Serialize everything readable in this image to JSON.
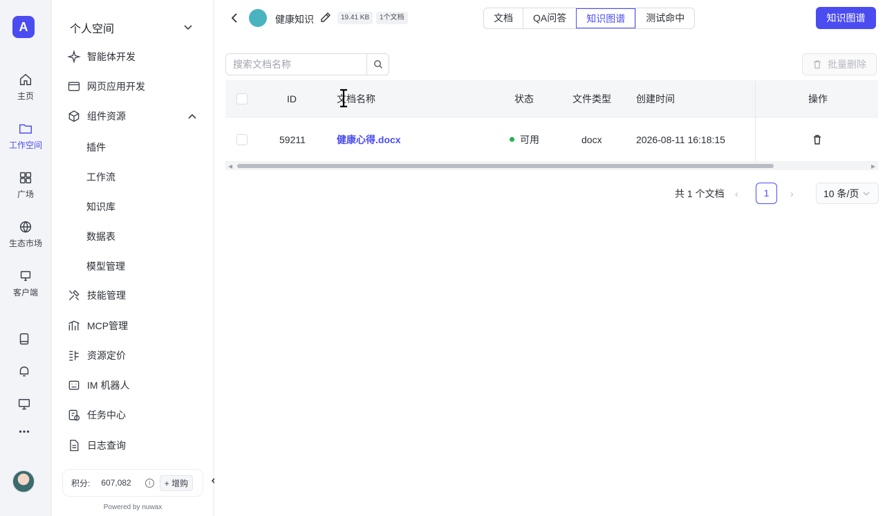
{
  "rail": {
    "logo": "A",
    "items": [
      {
        "label": "主页",
        "icon": "home-icon"
      },
      {
        "label": "工作空间",
        "icon": "folder-icon",
        "active": true
      },
      {
        "label": "广场",
        "icon": "grid-icon"
      },
      {
        "label": "生态市场",
        "icon": "globe-icon"
      },
      {
        "label": "客户端",
        "icon": "monitor-icon"
      }
    ],
    "bottom_icons": [
      "book-icon",
      "bell-icon",
      "desktop-icon",
      "more-icon"
    ]
  },
  "sidebar": {
    "title": "个人空间",
    "items": [
      {
        "label": "智能体开发",
        "icon": "sparkle-icon"
      },
      {
        "label": "网页应用开发",
        "icon": "browser-icon"
      },
      {
        "label": "组件资源",
        "icon": "cube-icon"
      },
      {
        "label": "技能管理",
        "icon": "tools-icon"
      },
      {
        "label": "MCP管理",
        "icon": "mcp-icon"
      },
      {
        "label": "资源定价",
        "icon": "pricing-icon"
      },
      {
        "label": "IM 机器人",
        "icon": "robot-icon"
      },
      {
        "label": "任务中心",
        "icon": "task-icon"
      },
      {
        "label": "日志查询",
        "icon": "log-icon"
      }
    ],
    "sub_items": [
      "插件",
      "工作流",
      "知识库",
      "数据表",
      "模型管理"
    ],
    "credit_label": "积分:",
    "credit_value": "607,082",
    "buy_label": "+ 增购",
    "powered": "Powered by nuwax"
  },
  "header": {
    "kb_name": "健康知识",
    "size_tag": "19.41 KB",
    "doc_tag": "1个文档",
    "tabs": [
      "文档",
      "QA问答",
      "知识图谱",
      "测试命中"
    ],
    "active_tab": "知识图谱",
    "primary_button": "知识图谱"
  },
  "toolbar": {
    "search_placeholder": "搜索文档名称",
    "bulk_delete": "批量删除"
  },
  "table": {
    "columns": [
      "ID",
      "文档名称",
      "状态",
      "文件类型",
      "创建时间",
      "操作"
    ],
    "rows": [
      {
        "id": "59211",
        "name": "健康心得.docx",
        "status": "可用",
        "type": "docx",
        "created": "2026-08-11 16:18:15"
      }
    ]
  },
  "pagination": {
    "total": "共 1 个文档",
    "current_page": "1",
    "page_size": "10 条/页"
  },
  "colors": {
    "accent": "#4b4cf0",
    "status_ok": "#23b14d"
  }
}
